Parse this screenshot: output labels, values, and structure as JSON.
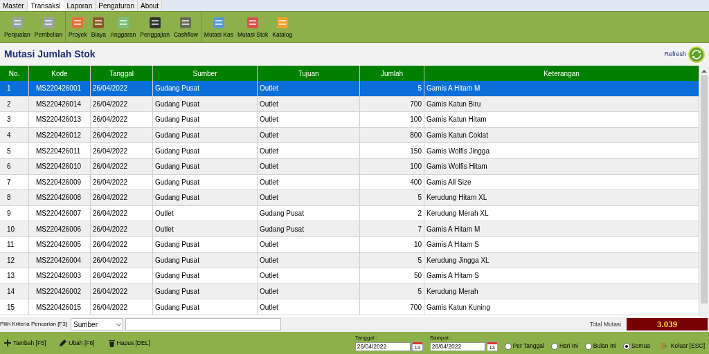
{
  "menu_tabs": [
    {
      "label": "Master",
      "selected": false
    },
    {
      "label": "Transaksi",
      "selected": true
    },
    {
      "label": "Laporan",
      "selected": false
    },
    {
      "label": "Pengaturan",
      "selected": false
    },
    {
      "label": "About",
      "selected": false
    }
  ],
  "toolbar": {
    "groups": [
      [
        "Penjualan",
        "Pembelian"
      ],
      [
        "Proyek",
        "Biaya",
        "Anggaran",
        "Penggajian",
        "Cashflow"
      ],
      [
        "Mutasi Kas",
        "Mutasi Stok",
        "Katalog"
      ]
    ]
  },
  "page_title": "Mutasi Jumlah Stok",
  "refresh_label": "Refresh",
  "table": {
    "columns": [
      "No.",
      "Kode",
      "Tanggal",
      "Sumber",
      "Tujuan",
      "Jumlah",
      "Keterangan"
    ],
    "rows": [
      {
        "selected": true,
        "cells": [
          "1",
          "MS220426001",
          "26/04/2022",
          "Gudang Pusat",
          "Outlet",
          "5",
          "Gamis A Hitam M"
        ]
      },
      {
        "selected": false,
        "cells": [
          "2",
          "MS220426014",
          "26/04/2022",
          "Gudang Pusat",
          "Outlet",
          "700",
          "Gamis Katun Biru"
        ]
      },
      {
        "selected": false,
        "cells": [
          "3",
          "MS220426013",
          "26/04/2022",
          "Gudang Pusat",
          "Outlet",
          "100",
          "Gamis Katun Hitam"
        ]
      },
      {
        "selected": false,
        "cells": [
          "4",
          "MS220426012",
          "26/04/2022",
          "Gudang Pusat",
          "Outlet",
          "800",
          "Gamis Katun Coklat"
        ]
      },
      {
        "selected": false,
        "cells": [
          "5",
          "MS220426011",
          "26/04/2022",
          "Gudang Pusat",
          "Outlet",
          "150",
          "Gamis Wolfis Jingga"
        ]
      },
      {
        "selected": false,
        "cells": [
          "6",
          "MS220426010",
          "26/04/2022",
          "Gudang Pusat",
          "Outlet",
          "100",
          "Gamis Wolfis Hitam"
        ]
      },
      {
        "selected": false,
        "cells": [
          "7",
          "MS220426009",
          "26/04/2022",
          "Gudang Pusat",
          "Outlet",
          "400",
          "Gamis All Size"
        ]
      },
      {
        "selected": false,
        "cells": [
          "8",
          "MS220426008",
          "26/04/2022",
          "Gudang Pusat",
          "Outlet",
          "5",
          "Kerudung Hitam XL"
        ]
      },
      {
        "selected": false,
        "cells": [
          "9",
          "MS220426007",
          "26/04/2022",
          "Outlet",
          "Gudang Pusat",
          "2",
          "Kerudung Merah XL"
        ]
      },
      {
        "selected": false,
        "cells": [
          "10",
          "MS220426006",
          "26/04/2022",
          "Outlet",
          "Gudang Pusat",
          "7",
          "Gamis A Hitam M"
        ]
      },
      {
        "selected": false,
        "cells": [
          "11",
          "MS220426005",
          "26/04/2022",
          "Gudang Pusat",
          "Outlet",
          "10",
          "Gamis A Hitam S"
        ]
      },
      {
        "selected": false,
        "cells": [
          "12",
          "MS220426004",
          "26/04/2022",
          "Gudang Pusat",
          "Outlet",
          "5",
          "Kerudung Jingga XL"
        ]
      },
      {
        "selected": false,
        "cells": [
          "13",
          "MS220426003",
          "26/04/2022",
          "Gudang Pusat",
          "Outlet",
          "50",
          "Gamis A Hitam S"
        ]
      },
      {
        "selected": false,
        "cells": [
          "14",
          "MS220426002",
          "26/04/2022",
          "Gudang Pusat",
          "Outlet",
          "5",
          "Kerudung Merah"
        ]
      },
      {
        "selected": false,
        "cells": [
          "15",
          "MS220426015",
          "26/04/2022",
          "Gudang Pusat",
          "Outlet",
          "700",
          "Gamis Katun Kuning"
        ]
      }
    ]
  },
  "search": {
    "label": "Pilih Kriteria Pencarian [F3]",
    "criteria": "Sumber"
  },
  "total": {
    "label": "Total Mutasi",
    "value": "3.039"
  },
  "actions": [
    "Tambah [F5]",
    "Ubah [F6]",
    "Hapus [DEL]"
  ],
  "date_from": {
    "label": "Tanggal :",
    "value": "26/04/2022",
    "calendar_day": "13"
  },
  "date_to": {
    "label": "Sampai :",
    "value": "26/04/2022",
    "calendar_day": "13"
  },
  "period_options": [
    {
      "label": "Per Tanggal",
      "selected": false
    },
    {
      "label": "Hari Ini",
      "selected": false
    },
    {
      "label": "Bulan Ini",
      "selected": false
    },
    {
      "label": "Semua",
      "selected": true
    }
  ],
  "exit_label": "Keluar [ESC]"
}
